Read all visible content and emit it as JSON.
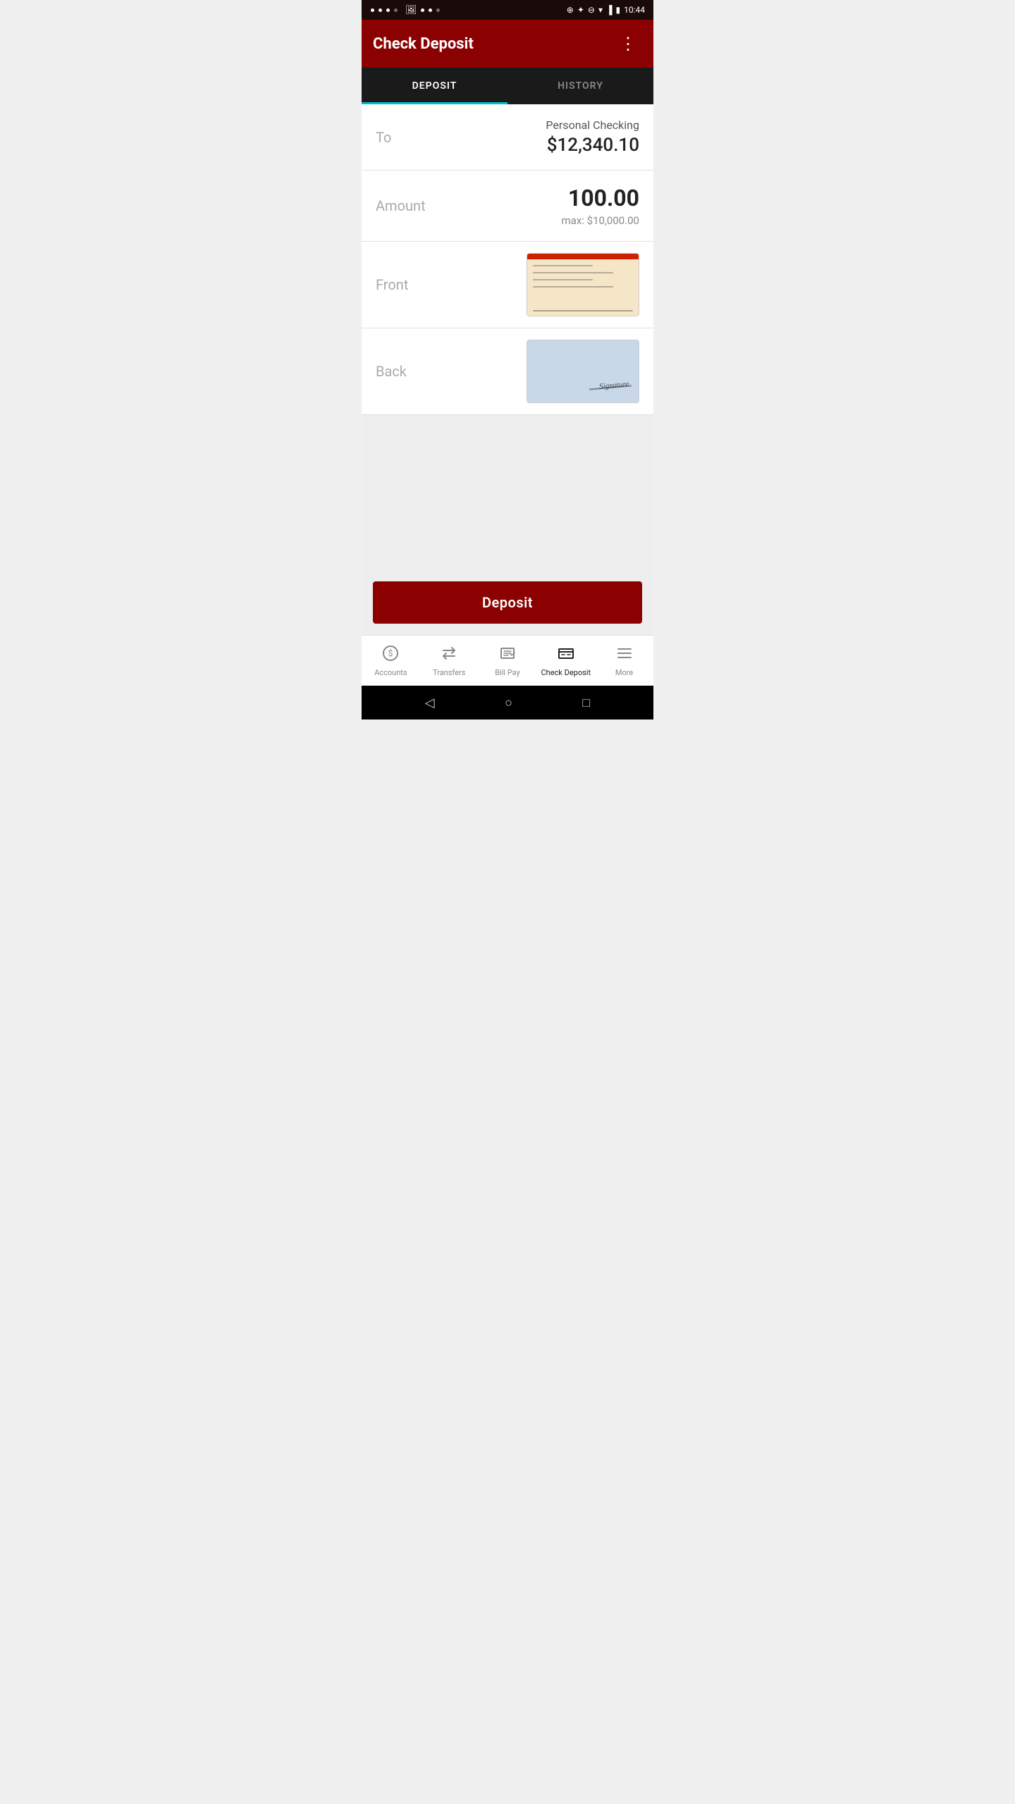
{
  "statusBar": {
    "time": "10:44"
  },
  "header": {
    "title": "Check Deposit",
    "menuIcon": "⋮"
  },
  "tabs": [
    {
      "id": "deposit",
      "label": "DEPOSIT",
      "active": true
    },
    {
      "id": "history",
      "label": "HISTORY",
      "active": false
    }
  ],
  "form": {
    "toLabel": "To",
    "accountName": "Personal Checking",
    "accountBalance": "$12,340.10",
    "amountLabel": "Amount",
    "amountValue": "100.00",
    "amountMax": "max: $10,000.00",
    "frontLabel": "Front",
    "backLabel": "Back"
  },
  "depositButton": {
    "label": "Deposit"
  },
  "bottomNav": [
    {
      "id": "accounts",
      "label": "Accounts",
      "icon": "$",
      "active": false
    },
    {
      "id": "transfers",
      "label": "Transfers",
      "icon": "⇄",
      "active": false
    },
    {
      "id": "billpay",
      "label": "Bill Pay",
      "icon": "▤",
      "active": false
    },
    {
      "id": "checkdeposit",
      "label": "Check Deposit",
      "icon": "≡",
      "active": true
    },
    {
      "id": "more",
      "label": "More",
      "icon": "☰",
      "active": false
    }
  ],
  "androidNav": {
    "back": "◁",
    "home": "○",
    "recents": "□"
  }
}
